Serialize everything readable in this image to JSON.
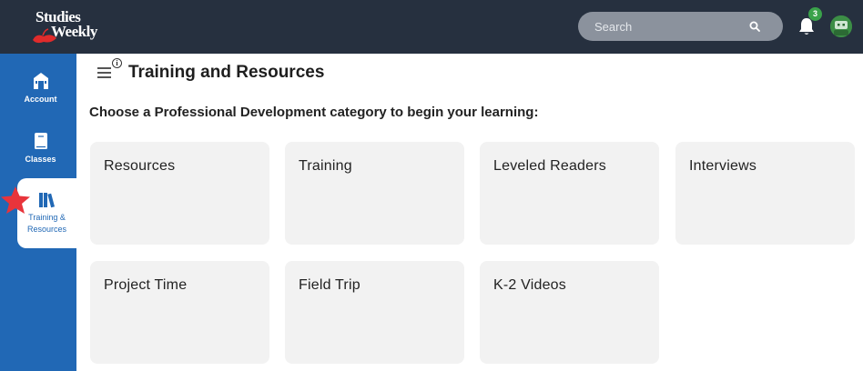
{
  "brand": {
    "line1": "Studies",
    "line2": "Weekly"
  },
  "search": {
    "placeholder": "Search"
  },
  "notifications": {
    "count": "3"
  },
  "sidebar": {
    "items": [
      {
        "label": "Account",
        "icon": "building-icon"
      },
      {
        "label": "Classes",
        "icon": "book-icon"
      },
      {
        "label": "Training & Resources",
        "icon": "books-icon",
        "active": true
      }
    ]
  },
  "main": {
    "title": "Training and Resources",
    "info": "i",
    "prompt": "Choose a Professional Development category to begin your learning:",
    "categories": [
      "Resources",
      "Training",
      "Leveled Readers",
      "Interviews",
      "Project Time",
      "Field Trip",
      "K-2 Videos"
    ]
  },
  "colors": {
    "topbar": "#26303f",
    "sidebar": "#2168b5",
    "card": "#f2f2f2",
    "badge": "#3aa24a",
    "star": "#e8343b"
  }
}
